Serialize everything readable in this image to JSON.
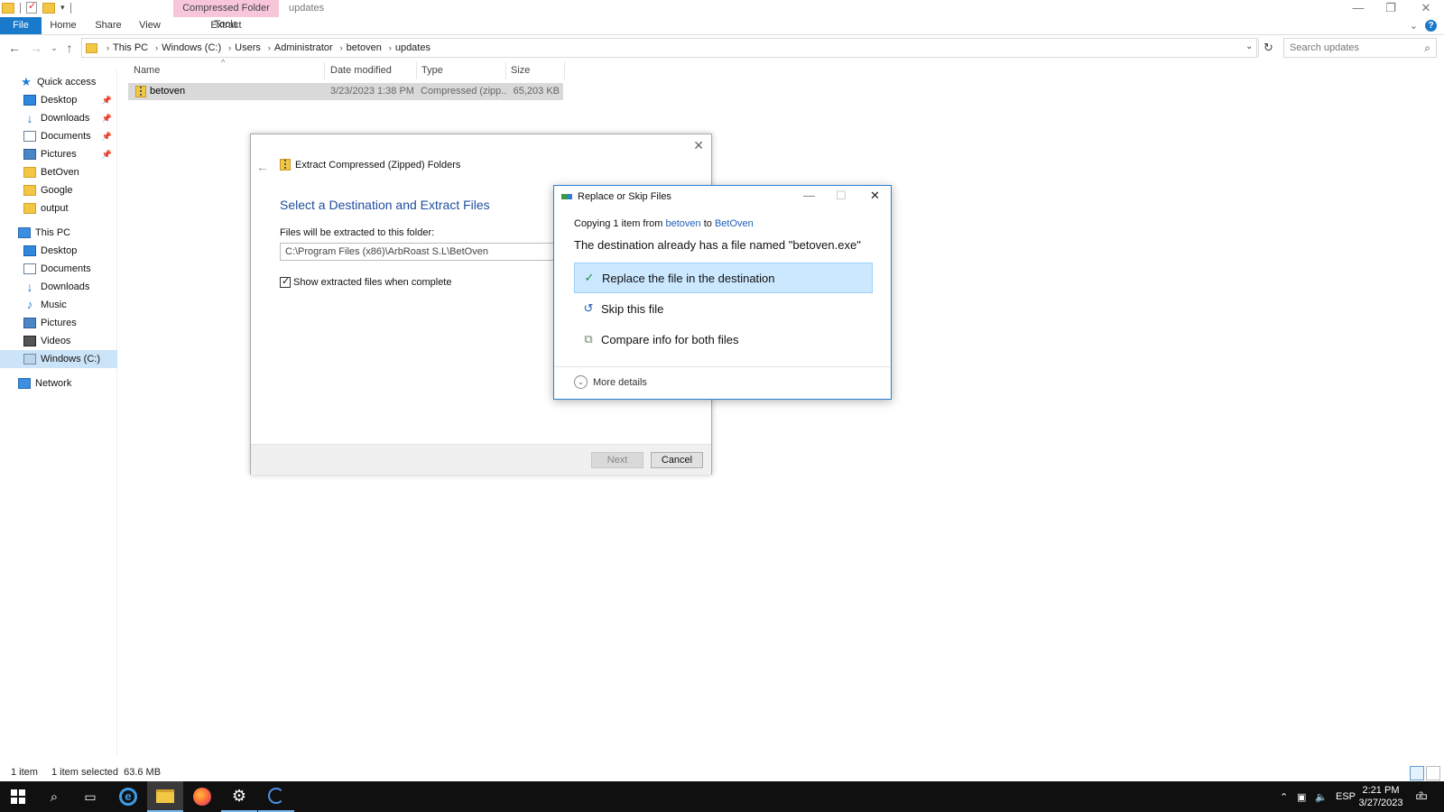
{
  "window": {
    "title": "updates",
    "context_group": "Compressed Folder Tools",
    "controls": {
      "minimize": "—",
      "restore": "❐",
      "close": "✕"
    }
  },
  "ribbon": {
    "tabs": [
      "File",
      "Home",
      "Share",
      "View",
      "Extract"
    ],
    "collapse_glyph": "⌄",
    "help": "?"
  },
  "address": {
    "crumbs": [
      "This PC",
      "Windows (C:)",
      "Users",
      "Administrator",
      "betoven",
      "updates"
    ],
    "search_placeholder": "Search updates"
  },
  "nav": {
    "quick_access": "Quick access",
    "quick_items": [
      "Desktop",
      "Downloads",
      "Documents",
      "Pictures",
      "BetOven",
      "Google",
      "output"
    ],
    "this_pc": "This PC",
    "pc_items": [
      "Desktop",
      "Documents",
      "Downloads",
      "Music",
      "Pictures",
      "Videos",
      "Windows (C:)"
    ],
    "network": "Network"
  },
  "filelist": {
    "columns": [
      "Name",
      "Date modified",
      "Type",
      "Size"
    ],
    "rows": [
      {
        "name": "betoven",
        "date": "3/23/2023 1:38 PM",
        "type": "Compressed (zipp...",
        "size": "65,203 KB"
      }
    ]
  },
  "status": {
    "count": "1 item",
    "selected": "1 item selected  63.6 MB"
  },
  "extract_dialog": {
    "title": "Extract Compressed (Zipped) Folders",
    "heading": "Select a Destination and Extract Files",
    "folder_label": "Files will be extracted to this folder:",
    "path": "C:\\Program Files (x86)\\ArbRoast S.L\\BetOven",
    "show_files": "Show extracted files when complete",
    "next": "Next",
    "cancel": "Cancel"
  },
  "replace_dialog": {
    "title": "Replace or Skip Files",
    "copying_prefix": "Copying 1 item from",
    "source": "betoven",
    "to_word": "to",
    "dest": "BetOven",
    "message": "The destination already has a file named \"betoven.exe\"",
    "option_replace": "Replace the file in the destination",
    "option_skip": "Skip this file",
    "option_compare": "Compare info for both files",
    "more_details": "More details"
  },
  "taskbar": {
    "ime": "ESP",
    "time": "2:21 PM",
    "date": "3/27/2023",
    "notifications": "2"
  }
}
